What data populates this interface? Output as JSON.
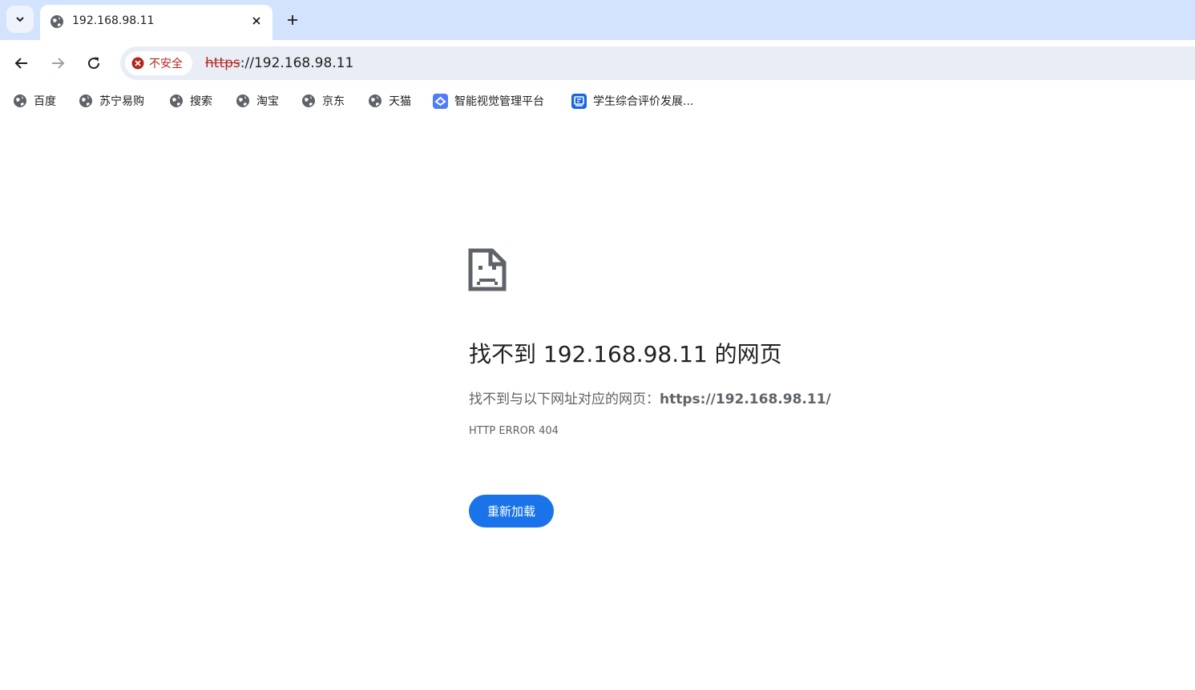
{
  "tab": {
    "title": "192.168.98.11"
  },
  "omnibox": {
    "security_label": "不安全",
    "url_scheme": "https",
    "url_rest": "://192.168.98.11"
  },
  "bookmarks": [
    {
      "label": "百度",
      "icon": "globe-icon"
    },
    {
      "label": "苏宁易购",
      "icon": "globe-icon"
    },
    {
      "label": "搜索",
      "icon": "globe-icon"
    },
    {
      "label": "淘宝",
      "icon": "globe-icon"
    },
    {
      "label": "京东",
      "icon": "globe-icon"
    },
    {
      "label": "天猫",
      "icon": "globe-icon"
    },
    {
      "label": "智能视觉管理平台",
      "icon": "vision-platform-icon"
    },
    {
      "label": "学生综合评价发展...",
      "icon": "student-eval-icon"
    }
  ],
  "error": {
    "title": "找不到 192.168.98.11 的网页",
    "desc_prefix": "找不到与以下网址对应的网页：",
    "desc_url": "https://192.168.98.11/",
    "code": "HTTP ERROR 404",
    "reload_label": "重新加载"
  },
  "colors": {
    "tabstrip": "#d3e3fd",
    "omnibox": "#e9eef6",
    "insecure": "#b3261e",
    "button": "#1a73e8"
  }
}
